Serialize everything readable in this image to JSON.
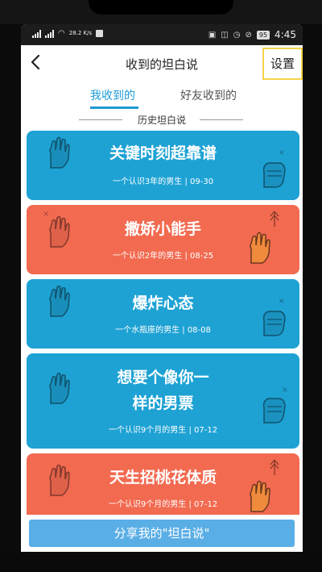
{
  "status_bar": {
    "network": "28.2 K/s",
    "battery": "95",
    "time": "4:45"
  },
  "nav": {
    "title": "收到的坦白说",
    "settings_label": "设置"
  },
  "tabs": [
    {
      "label": "我收到的",
      "active": true
    },
    {
      "label": "好友收到的",
      "active": false
    }
  ],
  "section_title": "历史坦白说",
  "cards": [
    {
      "title": "关键时刻超靠谱",
      "meta": "一个认识3年的男生 | 09-30",
      "color": "blue"
    },
    {
      "title": "撒娇小能手",
      "meta": "一个认识2年的男生 | 08-25",
      "color": "red"
    },
    {
      "title": "爆炸心态",
      "meta": "一个水瓶座的男生 | 08-08",
      "color": "blue"
    },
    {
      "title": "想要个像你一样的男票",
      "title_line1": "想要个像你一",
      "title_line2": "样的男票",
      "meta": "一个认识9个月的男生 | 07-12",
      "color": "blue"
    },
    {
      "title": "天生招桃花体质",
      "meta": "一个认识9个月的男生 | 07-12",
      "color": "red"
    }
  ],
  "share_button": "分享我的\"坦白说\"",
  "colors": {
    "accent": "#1d9bd4",
    "card_blue": "#1ea2d4",
    "card_red": "#f26a50",
    "share_button": "#5aaee6",
    "settings_highlight": "#f5d44a"
  }
}
